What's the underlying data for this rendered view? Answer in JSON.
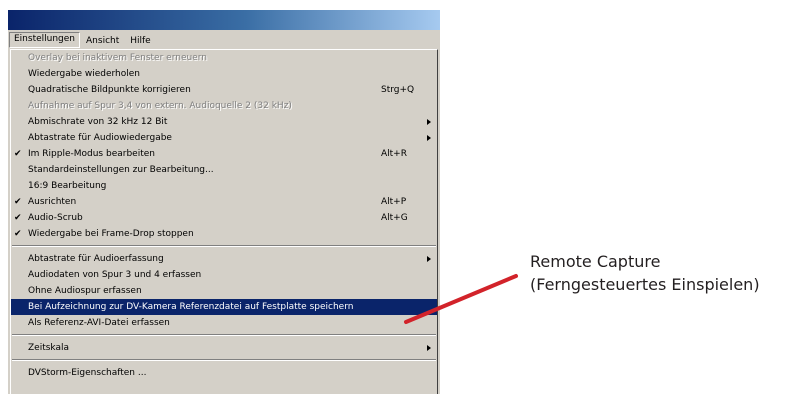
{
  "menubar": {
    "items": [
      {
        "label": "Einstellungen",
        "open": true
      },
      {
        "label": "Ansicht",
        "open": false
      },
      {
        "label": "Hilfe",
        "open": false
      }
    ]
  },
  "menu": {
    "groups": [
      [
        {
          "label": "Overlay bei inaktivem Fenster erneuern",
          "disabled": true
        },
        {
          "label": "Wiedergabe wiederholen"
        },
        {
          "label": "Quadratische Bildpunkte korrigieren",
          "shortcut": "Strg+Q"
        },
        {
          "label": "Aufnahme auf Spur 3,4 von extern. Audioquelle 2 (32 kHz)",
          "disabled": true
        },
        {
          "label": "Abmischrate von 32 kHz 12 Bit",
          "submenu": true
        },
        {
          "label": "Abtastrate für Audiowiedergabe",
          "submenu": true
        },
        {
          "label": "Im Ripple-Modus bearbeiten",
          "checked": true,
          "shortcut": "Alt+R"
        },
        {
          "label": "Standardeinstellungen zur Bearbeitung..."
        },
        {
          "label": "16:9 Bearbeitung"
        },
        {
          "label": "Ausrichten",
          "checked": true,
          "shortcut": "Alt+P"
        },
        {
          "label": "Audio-Scrub",
          "checked": true,
          "shortcut": "Alt+G"
        },
        {
          "label": "Wiedergabe bei Frame-Drop stoppen",
          "checked": true
        }
      ],
      [
        {
          "label": "Abtastrate für Audioerfassung",
          "submenu": true
        },
        {
          "label": "Audiodaten von Spur 3 und 4 erfassen"
        },
        {
          "label": "Ohne Audiospur erfassen"
        },
        {
          "label": "Bei Aufzeichnung zur DV-Kamera Referenzdatei auf Festplatte speichern",
          "highlighted": true
        },
        {
          "label": "Als Referenz-AVI-Datei erfassen"
        }
      ],
      [
        {
          "label": "Zeitskala",
          "submenu": true
        }
      ],
      [
        {
          "label": "DVStorm-Eigenschaften ..."
        }
      ]
    ]
  },
  "callout": {
    "line1": "Remote Capture",
    "line2": "(Ferngesteuertes  Einspielen)",
    "line_color": "#d2232a"
  },
  "colors": {
    "menu_bg": "#d4d0c8",
    "highlight_bg": "#0a246a",
    "titlebar_start": "#0a246a",
    "titlebar_end": "#a6caf0"
  }
}
